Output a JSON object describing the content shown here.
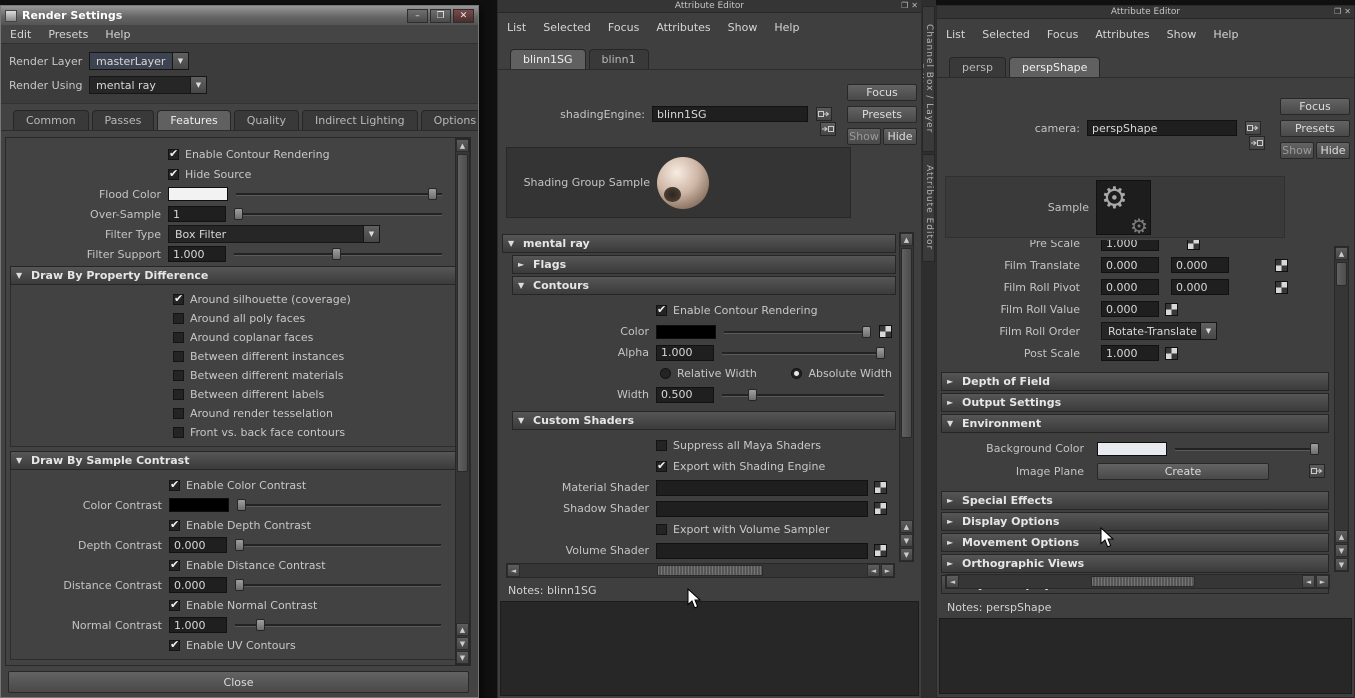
{
  "colors": {
    "panel_bg": "#3f3f3f",
    "field_bg": "#1f1f1f",
    "section_header": "#4a4a4a",
    "flood_color_swatch": "#f2f2f2",
    "color_contrast_swatch": "#000000",
    "contour_color_swatch": "#000000",
    "background_color_swatch": "#e9e9f0"
  },
  "rs": {
    "title": "Render Settings",
    "window_buttons": {
      "min": "–",
      "max": "❐",
      "close": "✕"
    },
    "menu": [
      "Edit",
      "Presets",
      "Help"
    ],
    "layer_label": "Render Layer",
    "layer_value": "masterLayer",
    "using_label": "Render Using",
    "using_value": "mental ray",
    "tabs": [
      "Common",
      "Passes",
      "Features",
      "Quality",
      "Indirect Lighting",
      "Options"
    ],
    "active_tab": "Features",
    "rows": {
      "enable_contour": {
        "label": "Enable Contour Rendering",
        "checked": true
      },
      "hide_source": {
        "label": "Hide Source",
        "checked": true
      },
      "flood_color": {
        "label": "Flood Color"
      },
      "over_sample": {
        "label": "Over-Sample",
        "value": "1"
      },
      "filter_type": {
        "label": "Filter Type",
        "value": "Box Filter"
      },
      "filter_support": {
        "label": "Filter Support",
        "value": "1.000"
      }
    },
    "prop_section": {
      "title": "Draw By Property Difference",
      "items": [
        {
          "label": "Around silhouette (coverage)",
          "checked": true
        },
        {
          "label": "Around all poly faces",
          "checked": false
        },
        {
          "label": "Around coplanar faces",
          "checked": false
        },
        {
          "label": "Between different instances",
          "checked": false
        },
        {
          "label": "Between different materials",
          "checked": false
        },
        {
          "label": "Between different labels",
          "checked": false
        },
        {
          "label": "Around render tesselation",
          "checked": false
        },
        {
          "label": "Front vs. back face contours",
          "checked": false
        }
      ]
    },
    "contrast_section": {
      "title": "Draw By Sample Contrast",
      "enable_color": {
        "label": "Enable Color Contrast",
        "checked": true
      },
      "color_contrast": {
        "label": "Color Contrast"
      },
      "enable_depth": {
        "label": "Enable Depth Contrast",
        "checked": true
      },
      "depth_contrast": {
        "label": "Depth Contrast",
        "value": "0.000"
      },
      "enable_distance": {
        "label": "Enable Distance Contrast",
        "checked": true
      },
      "distance_contrast": {
        "label": "Distance Contrast",
        "value": "0.000"
      },
      "enable_normal": {
        "label": "Enable Normal Contrast",
        "checked": true
      },
      "normal_contrast": {
        "label": "Normal Contrast",
        "value": "1.000"
      },
      "enable_uv": {
        "label": "Enable UV Contours",
        "checked": true
      }
    },
    "close_label": "Close"
  },
  "ae1": {
    "title": "Attribute Editor",
    "menu": [
      "List",
      "Selected",
      "Focus",
      "Attributes",
      "Show",
      "Help"
    ],
    "tabs": [
      "blinn1SG",
      "blinn1"
    ],
    "shading_engine": {
      "label": "shadingEngine:",
      "value": "blinn1SG"
    },
    "buttons": {
      "focus": "Focus",
      "presets": "Presets",
      "show": "Show",
      "hide": "Hide"
    },
    "sample_label": "Shading Group Sample",
    "sections": {
      "mental_ray": "mental ray",
      "flags": "Flags",
      "contours": "Contours",
      "custom_shaders": "Custom Shaders"
    },
    "contours": {
      "enable": {
        "label": "Enable Contour Rendering",
        "checked": true
      },
      "color_label": "Color",
      "alpha": {
        "label": "Alpha",
        "value": "1.000"
      },
      "relative_width": {
        "label": "Relative Width",
        "selected": false
      },
      "absolute_width": {
        "label": "Absolute Width",
        "selected": true
      },
      "width": {
        "label": "Width",
        "value": "0.500"
      }
    },
    "custom": {
      "suppress": {
        "label": "Suppress all Maya Shaders",
        "checked": false
      },
      "export_shading": {
        "label": "Export with Shading Engine",
        "checked": true
      },
      "material_label": "Material Shader",
      "shadow_label": "Shadow Shader",
      "export_volume": {
        "label": "Export with Volume Sampler",
        "checked": false
      },
      "volume_label": "Volume Shader"
    },
    "notes_label": "Notes:  blinn1SG"
  },
  "ae2": {
    "title": "Attribute Editor",
    "menu": [
      "List",
      "Selected",
      "Focus",
      "Attributes",
      "Show",
      "Help"
    ],
    "tabs": [
      "persp",
      "perspShape"
    ],
    "camera": {
      "label": "camera:",
      "value": "perspShape"
    },
    "buttons": {
      "focus": "Focus",
      "presets": "Presets",
      "show": "Show",
      "hide": "Hide"
    },
    "sample_label": "Sample",
    "rows": [
      {
        "label": "Pre Scale",
        "v1": "1.000"
      },
      {
        "label": "Film Translate",
        "v1": "0.000",
        "v2": "0.000"
      },
      {
        "label": "Film Roll Pivot",
        "v1": "0.000",
        "v2": "0.000"
      },
      {
        "label": "Film Roll Value",
        "v1": "0.000"
      },
      {
        "label": "Film Roll Order",
        "value": "Rotate-Translate"
      },
      {
        "label": "Post Scale",
        "v1": "1.000"
      }
    ],
    "sections": [
      "Depth of Field",
      "Output Settings",
      "Environment",
      "Special Effects",
      "Display Options",
      "Movement Options",
      "Orthographic Views",
      "Object Display"
    ],
    "environment": {
      "bg_label": "Background Color",
      "image_plane_label": "Image Plane",
      "create_label": "Create"
    },
    "notes_label": "Notes:  perspShape"
  },
  "side_tabs": [
    "Channel Box / Layer Editor",
    "Attribute Editor"
  ]
}
